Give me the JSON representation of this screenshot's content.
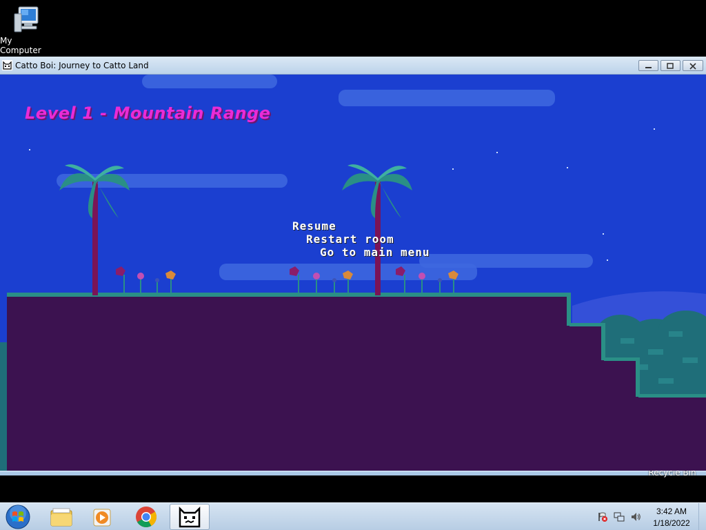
{
  "desktop": {
    "icons": [
      {
        "label": "My Computer"
      },
      {
        "label": "Recycle Bin"
      }
    ]
  },
  "window": {
    "title": "Catto Boi: Journey to Catto Land"
  },
  "game": {
    "level_title": "Level 1 - Mountain Range",
    "pause_menu": [
      "Resume",
      "Restart room",
      "Go to main menu"
    ],
    "colors": {
      "sky": "#1b3fd0",
      "ground": "#3c1250",
      "grass": "#2a8f86",
      "title": "#ea2bd6"
    }
  },
  "taskbar": {
    "pinned": [
      "start-orb-icon",
      "windows-explorer-icon",
      "media-player-icon",
      "chrome-icon",
      "catto-game-icon"
    ],
    "clock": {
      "time": "3:42 AM",
      "date": "1/18/2022"
    }
  }
}
